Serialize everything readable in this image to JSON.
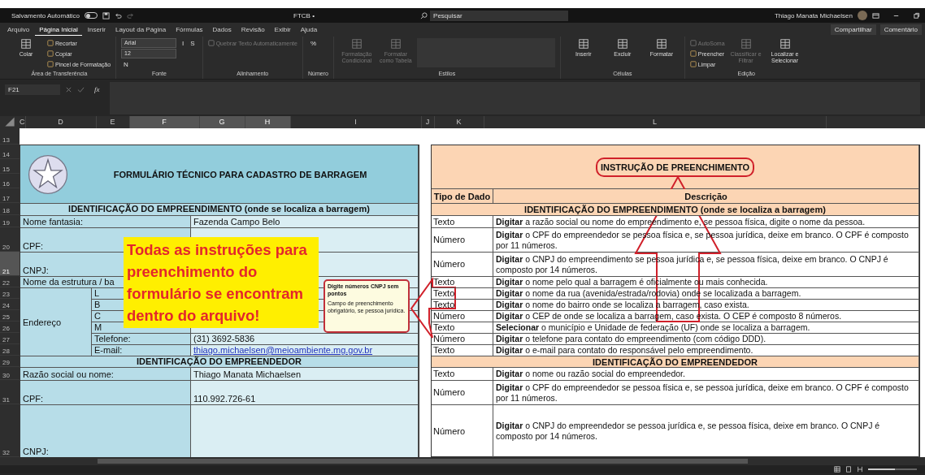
{
  "titlebar": {
    "autosave_label": "Salvamento Automático",
    "autosave_on": false,
    "file_name": "FTCB •",
    "search_placeholder": "Pesquisar",
    "user_name": "Thiago Manata Michaelsen"
  },
  "menu_tabs": [
    {
      "label": "Arquivo",
      "selected": false
    },
    {
      "label": "Página Inicial",
      "selected": true
    },
    {
      "label": "Inserir",
      "selected": false
    },
    {
      "label": "Layout da Página",
      "selected": false
    },
    {
      "label": "Fórmulas",
      "selected": false
    },
    {
      "label": "Dados",
      "selected": false
    },
    {
      "label": "Revisão",
      "selected": false
    },
    {
      "label": "Exibir",
      "selected": false
    },
    {
      "label": "Ajuda",
      "selected": false
    }
  ],
  "share_buttons": [
    "Compartilhar",
    "Comentário"
  ],
  "ribbon": [
    {
      "label": "Área de Transferência",
      "items": [
        {
          "kind": "large",
          "label": "Colar",
          "disabled": false
        },
        {
          "kind": "small",
          "label": "Recortar",
          "disabled": false
        },
        {
          "kind": "small",
          "label": "Copiar",
          "disabled": false
        },
        {
          "kind": "small",
          "label": "Pincel de Formatação",
          "disabled": false
        }
      ]
    },
    {
      "label": "Fonte",
      "items": [
        {
          "kind": "field",
          "label": "Arial",
          "disabled": false
        },
        {
          "kind": "field",
          "label": "12",
          "disabled": false
        },
        {
          "kind": "glyph",
          "label": "N",
          "disabled": false
        },
        {
          "kind": "glyph",
          "label": "I",
          "disabled": false
        },
        {
          "kind": "glyph",
          "label": "S",
          "disabled": false
        }
      ]
    },
    {
      "label": "Alinhamento",
      "items": [
        {
          "kind": "small",
          "label": "Quebrar Texto Automaticamente",
          "disabled": true
        }
      ]
    },
    {
      "label": "Número",
      "items": [
        {
          "kind": "glyph",
          "label": "%",
          "disabled": false
        }
      ]
    },
    {
      "label": "Estilos",
      "items": [
        {
          "kind": "large",
          "label": "Formatação Condicional",
          "disabled": true
        },
        {
          "kind": "large",
          "label": "Formatar como Tabela",
          "disabled": true
        },
        {
          "kind": "gallery",
          "disabled": true
        }
      ]
    },
    {
      "label": "Células",
      "items": [
        {
          "kind": "large",
          "label": "Inserir",
          "disabled": false
        },
        {
          "kind": "large",
          "label": "Excluir",
          "disabled": false
        },
        {
          "kind": "large",
          "label": "Formatar",
          "disabled": false
        }
      ]
    },
    {
      "label": "Edição",
      "items": [
        {
          "kind": "small",
          "label": "AutoSoma",
          "disabled": true
        },
        {
          "kind": "small",
          "label": "Preencher",
          "disabled": false
        },
        {
          "kind": "small",
          "label": "Limpar",
          "disabled": false
        },
        {
          "kind": "large",
          "label": "Classificar e Filtrar",
          "disabled": true
        },
        {
          "kind": "large",
          "label": "Localizar e Selecionar",
          "disabled": false
        }
      ]
    }
  ],
  "formula_bar": {
    "name_box": "F21",
    "function_label": "fx"
  },
  "column_headers": [
    {
      "label": "C",
      "selected": false
    },
    {
      "label": "D",
      "selected": false
    },
    {
      "label": "E",
      "selected": false
    },
    {
      "label": "F",
      "selected": true
    },
    {
      "label": "G",
      "selected": true
    },
    {
      "label": "H",
      "selected": true
    },
    {
      "label": "I",
      "selected": false
    },
    {
      "label": "J",
      "selected": false
    },
    {
      "label": "K",
      "selected": false
    },
    {
      "label": "L",
      "selected": false
    }
  ],
  "row_numbers": [
    {
      "label": "13",
      "selected": false
    },
    {
      "label": "14",
      "selected": false
    },
    {
      "label": "15",
      "selected": false
    },
    {
      "label": "16",
      "selected": false
    },
    {
      "label": "17",
      "selected": false
    },
    {
      "label": "18",
      "selected": false
    },
    {
      "label": "19",
      "selected": false
    },
    {
      "label": "20",
      "selected": false
    },
    {
      "label": "21",
      "selected": true
    },
    {
      "label": "22",
      "selected": false
    },
    {
      "label": "23",
      "selected": false
    },
    {
      "label": "24",
      "selected": false
    },
    {
      "label": "25",
      "selected": false
    },
    {
      "label": "26",
      "selected": false
    },
    {
      "label": "27",
      "selected": false
    },
    {
      "label": "28",
      "selected": false
    },
    {
      "label": "29",
      "selected": false
    },
    {
      "label": "30",
      "selected": false
    },
    {
      "label": "31",
      "selected": false
    },
    {
      "label": "32",
      "selected": false
    }
  ],
  "form": {
    "title": "FORMULÁRIO TÉCNICO PARA CADASTRO DE BARRAGEM",
    "sections": [
      {
        "title": "IDENTIFICAÇÃO DO EMPREENDIMENTO (onde se localiza a barragem)",
        "fields": [
          {
            "kind": "text",
            "label": "Nome fantasia:",
            "value": "Fazenda Campo Belo"
          },
          {
            "kind": "text",
            "label": "CPF:"
          },
          {
            "kind": "text",
            "label": "CNPJ:"
          },
          {
            "kind": "text",
            "label": "Nome da estrutura / ba"
          },
          {
            "kind": "group",
            "label": "Endereço",
            "children": [
              {
                "kind": "text",
                "label": "L"
              },
              {
                "kind": "text",
                "label": "B"
              },
              {
                "kind": "text",
                "label": "C"
              },
              {
                "kind": "text",
                "label": "M"
              },
              {
                "kind": "text",
                "label": "Telefone:",
                "value": "(31) 3692-5836"
              },
              {
                "kind": "link",
                "label": "E-mail:",
                "value": "thiago.michaelsen@meioambiente.mg.gov.br"
              }
            ]
          }
        ]
      },
      {
        "title": "IDENTIFICAÇÃO DO EMPREENDEDOR",
        "fields": [
          {
            "kind": "text",
            "label": "Razão social ou nome:",
            "value": "Thiago Manata Michaelsen"
          },
          {
            "kind": "text",
            "label": "CPF:",
            "value": "110.992.726-61"
          },
          {
            "kind": "text",
            "label": "CNPJ:"
          }
        ]
      }
    ]
  },
  "instructions": {
    "title": "INSTRUÇÃO DE PREENCHIMENTO",
    "columns": [
      "Tipo de Dado",
      "Descrição"
    ],
    "sections": [
      {
        "title": "IDENTIFICAÇÃO DO EMPREENDIMENTO (onde se localiza a barragem)",
        "rows": [
          {
            "type": "Texto",
            "description": "**Digitar** a razão social ou nome do empreendimento e, se pessoa física, digite o nome da pessoa."
          },
          {
            "type": "Número",
            "description": "**Digitar** o CPF do empreendedor se pessoa física e, se pessoa jurídica, deixe em branco. O CPF é composto por 11 números."
          },
          {
            "type": "Número",
            "description": "**Digitar** o CNPJ do empreendimento se pessoa jurídica e, se pessoa física, deixe em branco. O CNPJ é composto por 14 números."
          },
          {
            "type": "Texto",
            "description": "**Digitar** o nome pelo qual a barragem é oficialmente ou mais conhecida."
          },
          {
            "type": "Texto",
            "description": "**Digitar** o nome da rua (avenida/estrada/rodovia) onde se localizada a barragem."
          },
          {
            "type": "Texto",
            "description": "**Digitar** o nome do bairro onde se localiza a barragem, caso exista."
          },
          {
            "type": "Número",
            "description": "**Digitar** o CEP de onde se localiza a barragem, caso exista. O CEP é composto 8 números."
          },
          {
            "type": "Texto",
            "description": "**Selecionar** o município e Unidade de federação (UF) onde se localiza a barragem."
          },
          {
            "type": "Número",
            "description": "**Digitar** o telefone para contato do empreendimento (com código DDD)."
          },
          {
            "type": "Texto",
            "description": "**Digitar** o e-mail para contato do responsável pelo empreendimento."
          }
        ]
      },
      {
        "title": "IDENTIFICAÇÃO DO EMPREENDEDOR",
        "rows": [
          {
            "type": "Texto",
            "description": "**Digitar** o nome ou razão social do empreendedor."
          },
          {
            "type": "Número",
            "description": "**Digitar** o CPF do empreendedor se pessoa física e, se pessoa jurídica, deixe em branco. O CPF é composto por 11 números."
          },
          {
            "type": "Número",
            "description": "**Digitar** o CNPJ do empreendedor se pessoa jurídica e, se pessoa física, deixe em branco. O CNPJ é composto por 14 números."
          }
        ]
      }
    ]
  },
  "callout": {
    "text": "Todas as instruções para preenchimento do formulário se encontram dentro do arquivo!"
  },
  "comment": {
    "title": "Digite números CNPJ sem pontos",
    "body": "Campo de preenchimento obrigatório, se pessoa jurídica."
  },
  "status_bar": {
    "zoom_slider": {
      "level": 0.55
    }
  }
}
